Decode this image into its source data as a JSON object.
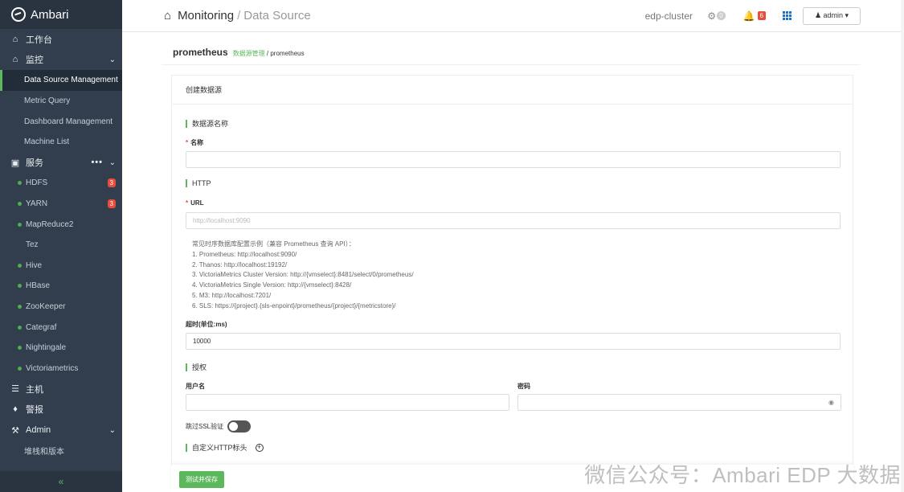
{
  "brand": {
    "name": "Ambari"
  },
  "sidebar": {
    "items": [
      {
        "label": "工作台",
        "icon": "home-icon"
      },
      {
        "label": "监控",
        "icon": "home-icon"
      },
      {
        "label": "Data Source Management"
      },
      {
        "label": "Metric Query"
      },
      {
        "label": "Dashboard Management"
      },
      {
        "label": "Machine List"
      },
      {
        "label": "服务",
        "icon": "briefcase-icon",
        "more": "•••"
      },
      {
        "label": "HDFS",
        "badge": "3"
      },
      {
        "label": "YARN",
        "badge": "3"
      },
      {
        "label": "MapReduce2"
      },
      {
        "label": "Tez"
      },
      {
        "label": "Hive"
      },
      {
        "label": "HBase"
      },
      {
        "label": "ZooKeeper"
      },
      {
        "label": "Categraf"
      },
      {
        "label": "Nightingale"
      },
      {
        "label": "Victoriametrics"
      },
      {
        "label": "主机",
        "icon": "server-icon"
      },
      {
        "label": "警报",
        "icon": "bell-icon"
      },
      {
        "label": "Admin",
        "icon": "wrench-icon"
      },
      {
        "label": "堆栈和版本"
      }
    ],
    "collapse_label": "«"
  },
  "topbar": {
    "breadcrumb_1": "Monitoring",
    "breadcrumb_sep": "/",
    "breadcrumb_2": "Data Source",
    "cluster": "edp-cluster",
    "ops_count": "0",
    "alerts_count": "6",
    "user": "admin ▾"
  },
  "page": {
    "title": "prometheus",
    "bc_link": "数据源管理",
    "bc_sep": " / ",
    "bc_cur": "prometheus"
  },
  "form": {
    "card_title": "创建数据源",
    "sec_name": "数据源名称",
    "name_label": "名称",
    "name_value": "",
    "sec_http": "HTTP",
    "url_label": "URL",
    "url_placeholder": "http://localhost:9090",
    "hints": [
      "常见时序数据库配置示例（兼容 Prometheus 查询 API）：",
      "1. Prometheus: http://localhost:9090/",
      "2. Thanos: http://localhost:19192/",
      "3. VictoriaMetrics Cluster Version: http://{vmselect}:8481/select/0/prometheus/",
      "4. VictoriaMetrics Single Version: http://{vmselect}:8428/",
      "5. M3: http://localhost:7201/",
      "6. SLS: https://{project}.{sls-enpoint}/prometheus/{project}/{metricstore}/"
    ],
    "timeout_label": "超时(单位:ms)",
    "timeout_value": "10000",
    "sec_auth": "授权",
    "username_label": "用户名",
    "password_label": "密码",
    "skip_ssl_label": "跳过SSL验证",
    "skip_ssl_enabled": false,
    "sec_headers": "自定义HTTP标头",
    "save_button": "测试并保存"
  },
  "watermark": "微信公众号：Ambari EDP 大数据",
  "colors": {
    "accent": "#5cb85c",
    "sidebar_bg": "#323e4d",
    "badge": "#e74c3c"
  }
}
